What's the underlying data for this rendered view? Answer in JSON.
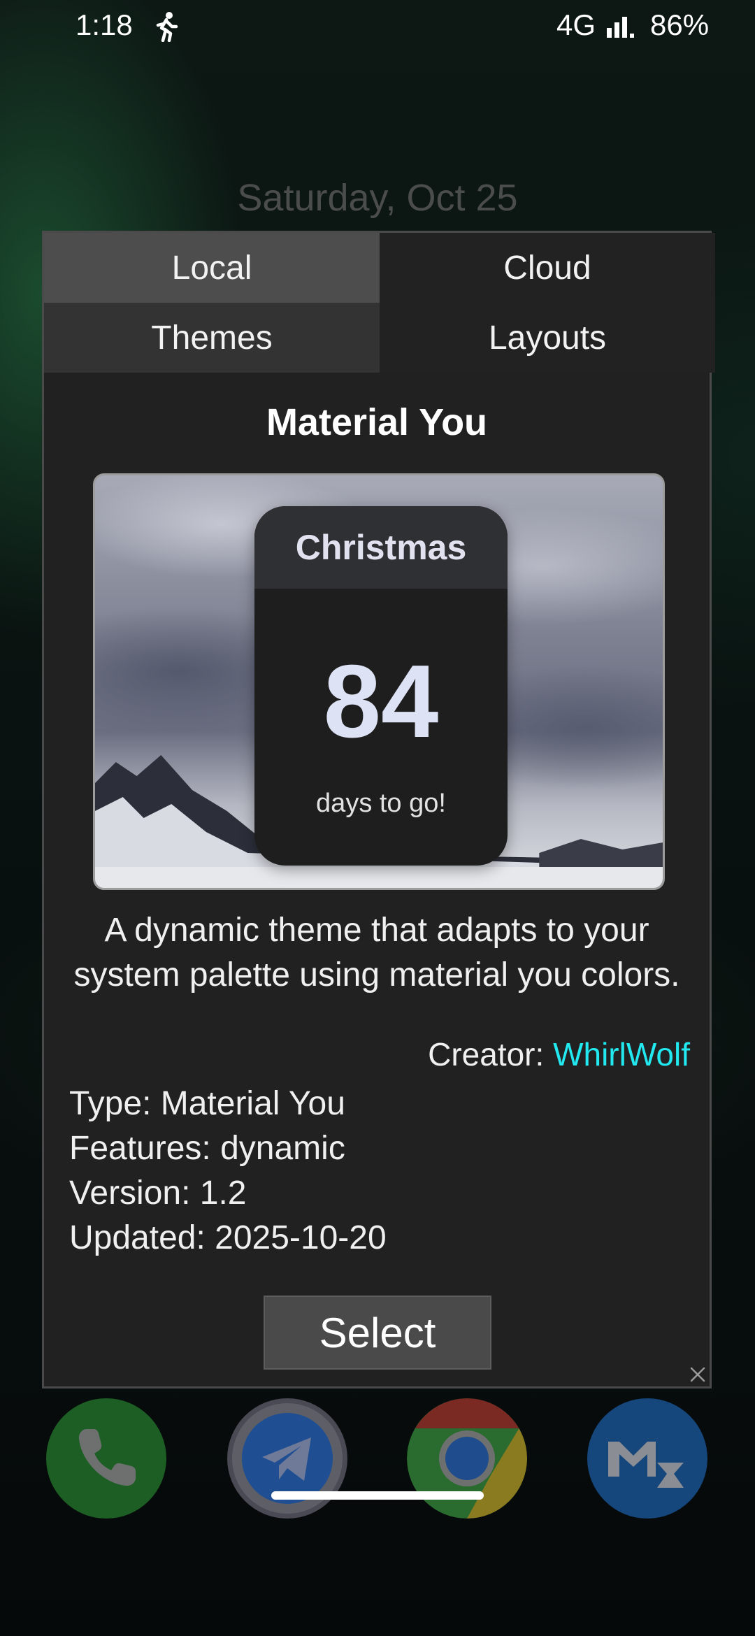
{
  "status_bar": {
    "time": "1:18",
    "network": "4G",
    "battery": "86%"
  },
  "home": {
    "date": "Saturday, Oct 25"
  },
  "dialog": {
    "tabs": {
      "local": "Local",
      "cloud": "Cloud",
      "themes": "Themes",
      "layouts": "Layouts"
    },
    "selected_tabs": [
      "Local",
      "Themes"
    ],
    "theme": {
      "name": "Material You",
      "preview": {
        "event": "Christmas",
        "count": "84",
        "caption": "days to go!"
      },
      "description": "A dynamic theme that adapts to your system palette using material you colors.",
      "creator_label": "Creator: ",
      "creator_name": "WhirlWolf",
      "type": "Type: Material You",
      "features": "Features: dynamic",
      "version": "Version: 1.2",
      "updated": "Updated: 2025-10-20"
    },
    "select_label": "Select",
    "accent_color": "#22e8f0"
  },
  "dock": {
    "apps": [
      "phone-icon",
      "telegram-icon",
      "chrome-icon",
      "gmail-icon"
    ]
  }
}
